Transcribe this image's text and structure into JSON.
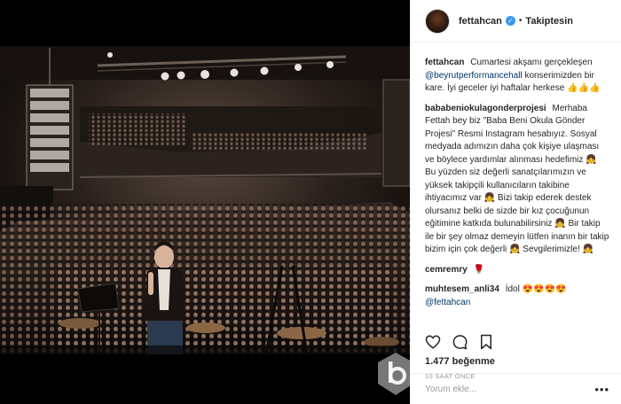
{
  "post": {
    "username": "fettahcan",
    "verified_glyph": "✓",
    "separator": "•",
    "follow_label": "Takiptesin",
    "likes": "1.477 beğenme",
    "time": "10 SAAT ÖNCE"
  },
  "comments": [
    {
      "user": "fettahcan",
      "text1": "Cumartesi akşamı gerçekleşen",
      "mention": "@beyrutperformancehall",
      "text2": "konserimizden bir kare. İyi geceler iyi haftalar herkese",
      "emojis": "👍👍👍"
    },
    {
      "user": "bababeniokulagonderprojesi",
      "p1": "Merhaba Fettah bey biz \"Baba Beni Okula Gönder Projesi\" Resmi Instagram hesabıyız. Sosyal medyada adımızın daha çok kişiye ulaşması ve böylece yardımlar alınması hedefimiz",
      "p2": "Bu yüzden siz değerli sanatçılarımızın ve yüksek takipçili kullanıcıların takibine ihtiyacımız var",
      "p3": "Bizi takip ederek destek olursanız belki de sizde bir kız çocuğunun eğitimine katkıda bulunabilirsiniz",
      "p4": "Bir takip ile bir şey olmaz demeyin lütfen inanın bir takip bizim için çok değerli",
      "p5": "Sevgilerimizle!",
      "emoji": "👧"
    },
    {
      "user": "cemremry",
      "emoji": "🌹"
    },
    {
      "user": "muhtesem_anli34",
      "text": "İdol",
      "emojis": "😍😍😍😍",
      "mention2": "@fettahcan"
    }
  ],
  "add_comment": {
    "placeholder": "Yorum ekle...",
    "more": "•••"
  },
  "icons": [
    "heart-icon",
    "comment-icon",
    "bookmark-icon",
    "more-options-icon",
    "watermark-logo"
  ],
  "colors": {
    "link": "#003569",
    "verified": "#3897f0",
    "muted": "#999999",
    "border": "#efefef"
  }
}
